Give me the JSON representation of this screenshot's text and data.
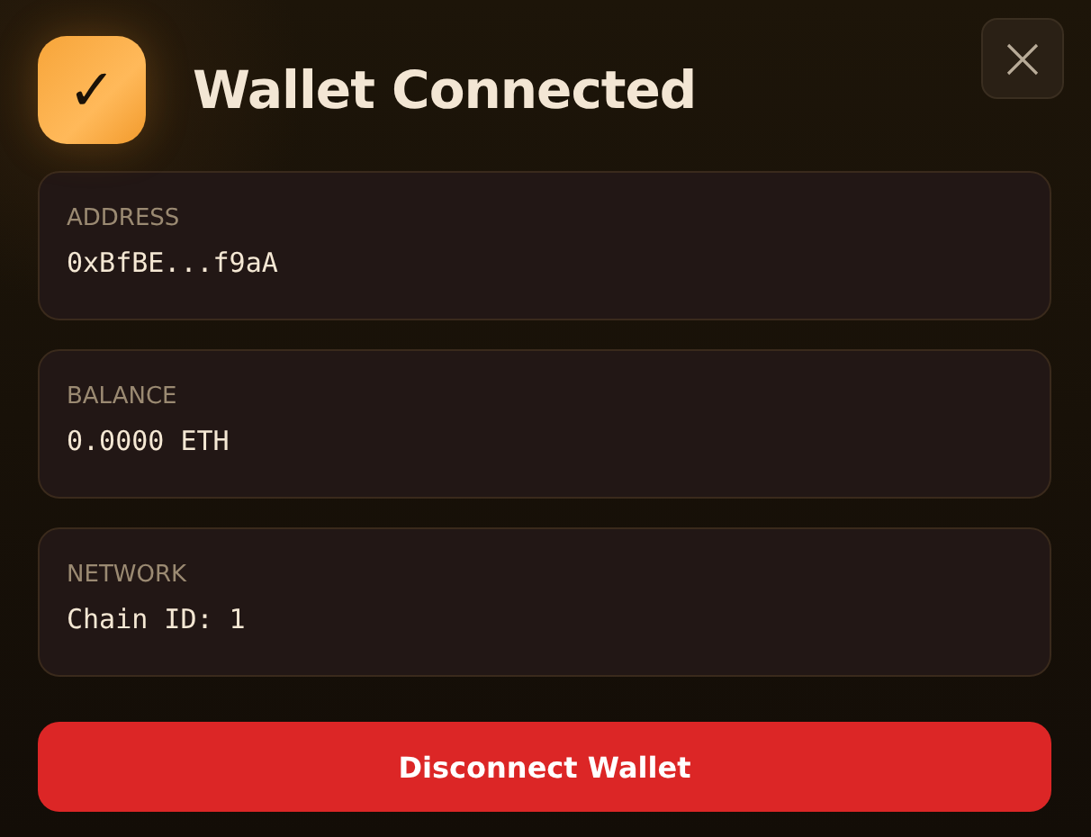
{
  "header": {
    "icon_glyph": "✓",
    "title": "Wallet Connected"
  },
  "fields": [
    {
      "label": "ADDRESS",
      "value": "0xBfBE...f9aA"
    },
    {
      "label": "BALANCE",
      "value": "0.0000 ETH"
    },
    {
      "label": "NETWORK",
      "value": "Chain ID: 1"
    }
  ],
  "button": "Disconnect Wallet"
}
